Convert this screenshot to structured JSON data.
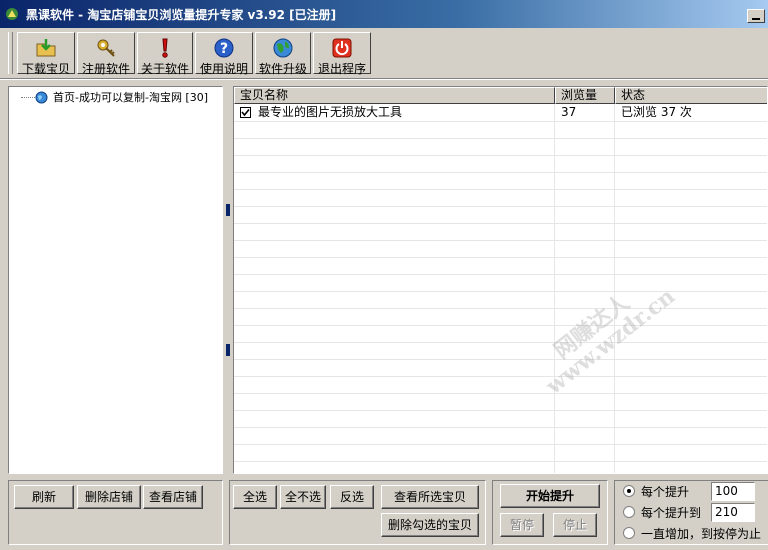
{
  "window": {
    "title": "黑课软件 - 淘宝店铺宝贝浏览量提升专家 v3.92 [已注册]"
  },
  "toolbar": {
    "buttons": [
      {
        "label": "下载宝贝",
        "icon": "folder-download-icon"
      },
      {
        "label": "注册软件",
        "icon": "key-register-icon"
      },
      {
        "label": "关于软件",
        "icon": "exclamation-icon"
      },
      {
        "label": "使用说明",
        "icon": "help-icon"
      },
      {
        "label": "软件升级",
        "icon": "globe-upgrade-icon"
      },
      {
        "label": "退出程序",
        "icon": "power-exit-icon"
      }
    ]
  },
  "tree": {
    "items": [
      {
        "label": "首页-成功可以复制-淘宝网 [30]",
        "icon": "globe-icon"
      }
    ]
  },
  "grid": {
    "columns": [
      "宝贝名称",
      "浏览量",
      "状态"
    ],
    "rows": [
      {
        "name": "最专业的图片无损放大工具",
        "views": "37",
        "status": "已浏览 37 次",
        "checked": true
      }
    ]
  },
  "watermark": {
    "line1": "网赚达人",
    "line2": "www.wzdr.cn"
  },
  "bottom": {
    "refresh": "刷新",
    "delete_shop": "删除店铺",
    "view_shop": "查看店铺",
    "select_all": "全选",
    "select_none": "全不选",
    "invert": "反选",
    "view_selected": "查看所选宝贝",
    "delete_checked": "删除勾选的宝贝",
    "start": "开始提升",
    "pause": "暂停",
    "stop": "停止",
    "options": [
      {
        "label": "每个提升",
        "value": "100",
        "selected": true
      },
      {
        "label": "每个提升到",
        "value": "210",
        "selected": false
      },
      {
        "label": "一直增加，到按停为止",
        "selected": false
      }
    ]
  },
  "colors": {
    "title_start": "#0a246a",
    "title_end": "#a6caf0",
    "face": "#d4d0c8"
  }
}
